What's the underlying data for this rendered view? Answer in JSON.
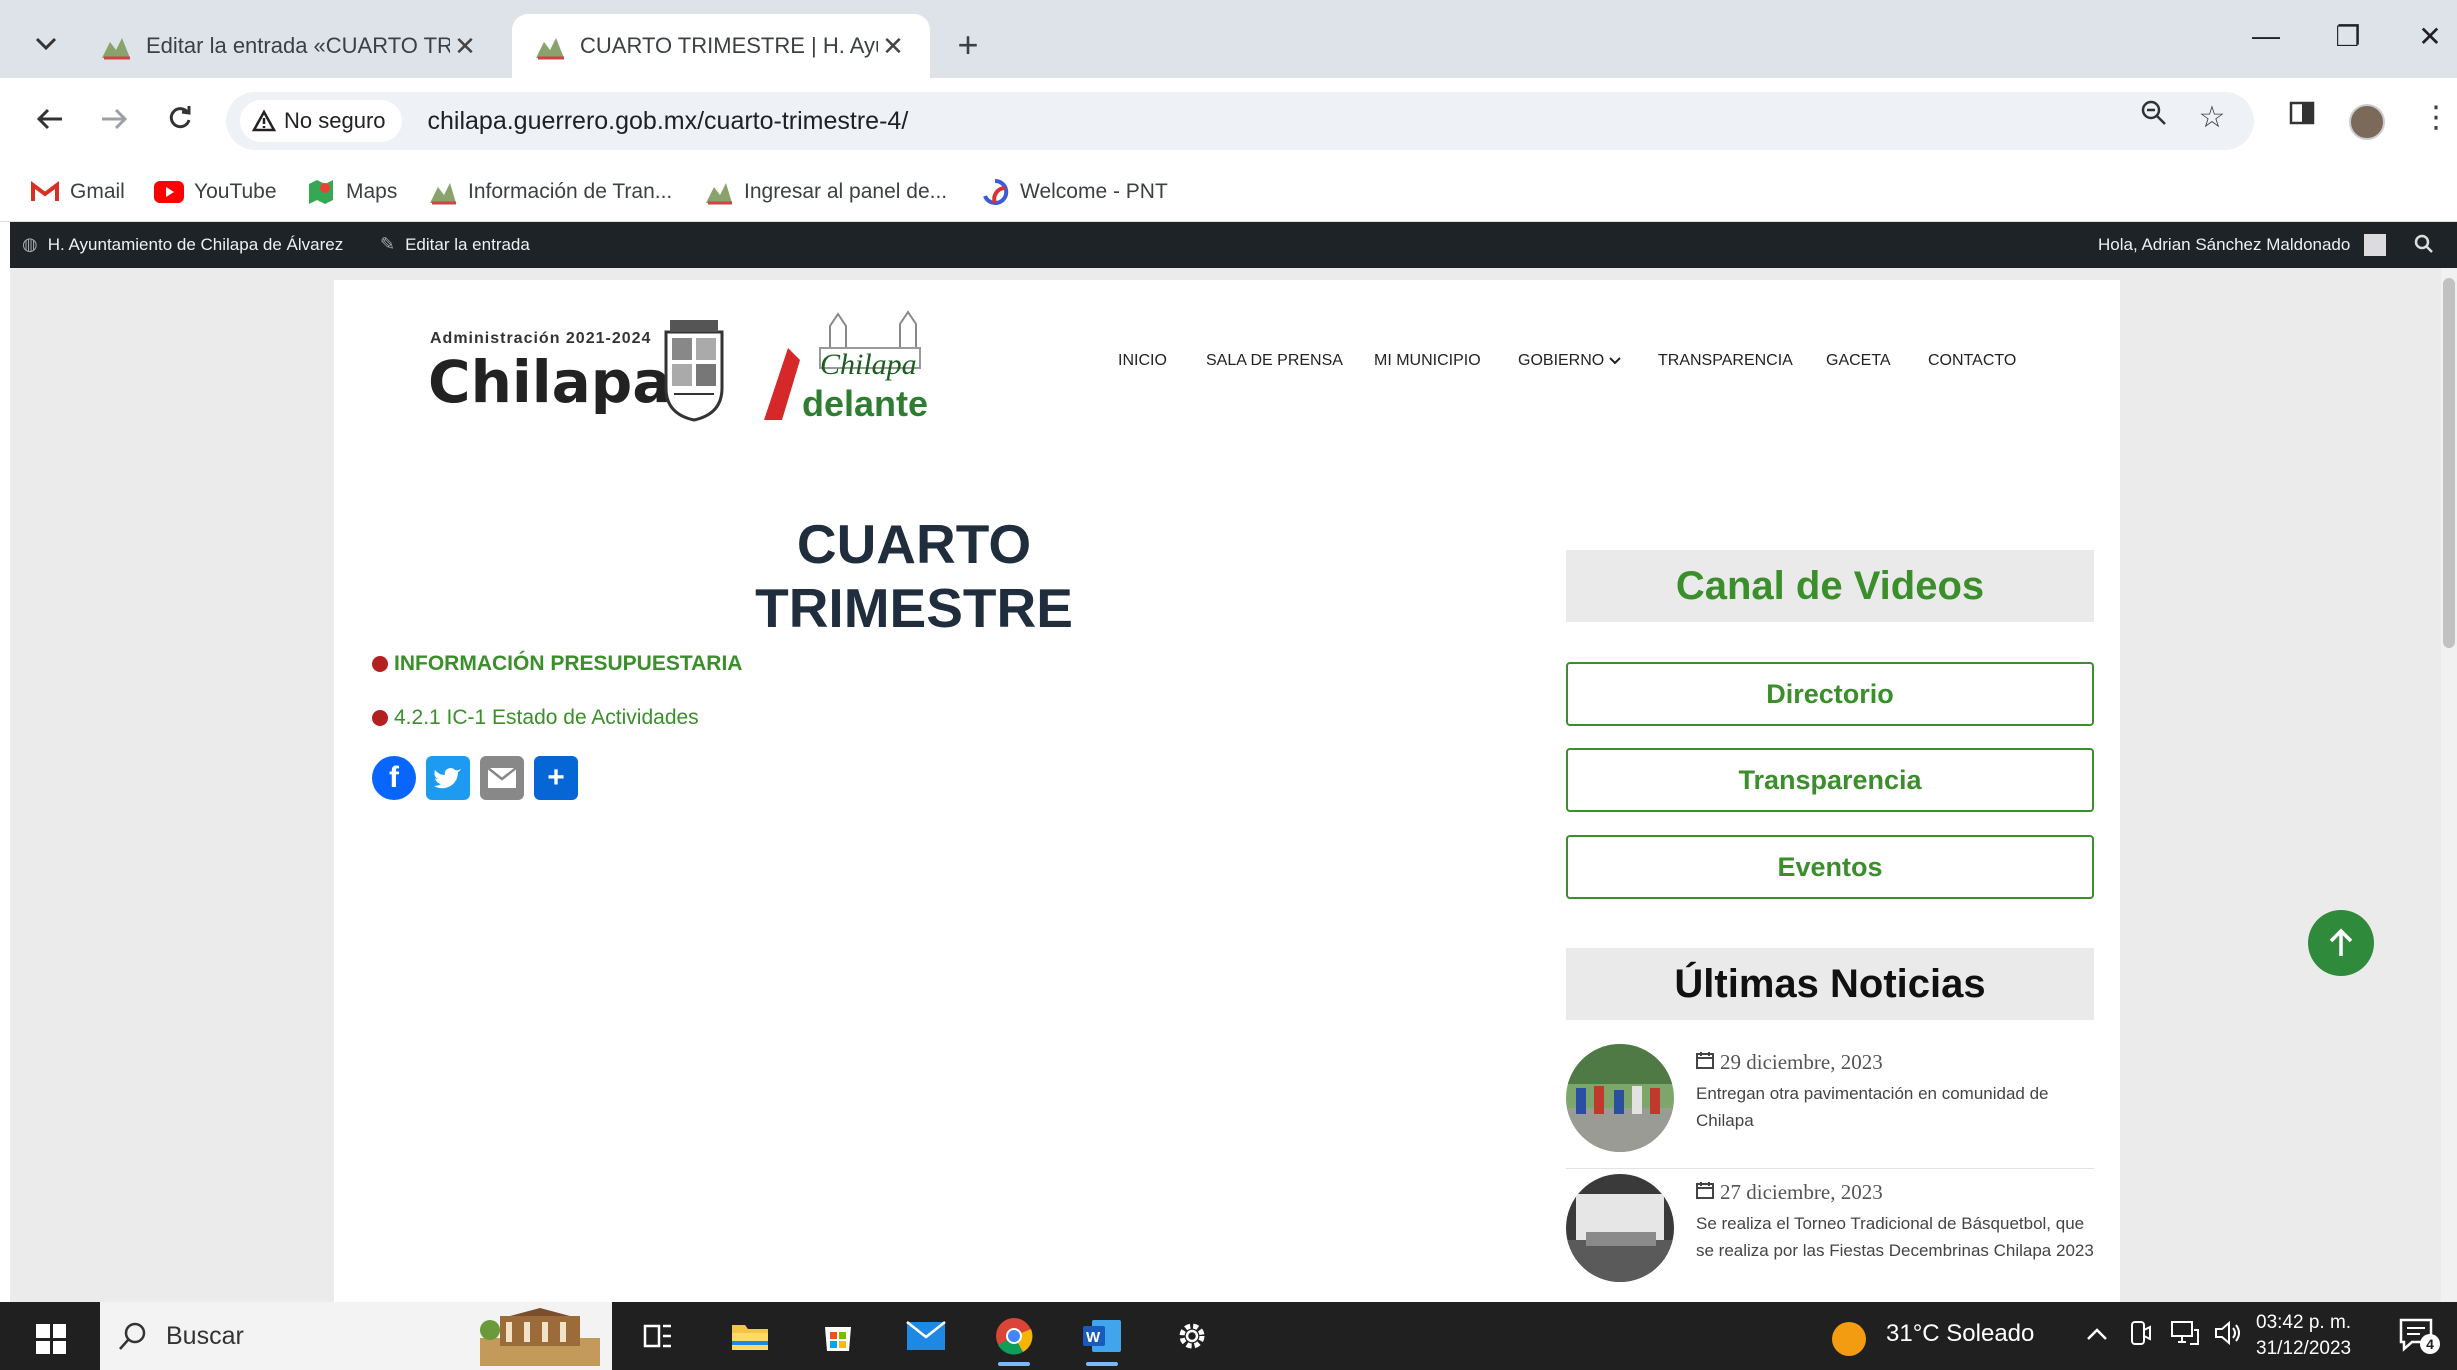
{
  "browser": {
    "tabs": [
      {
        "title": "Editar la entrada «CUARTO TRIMESTRE",
        "close": "✕"
      },
      {
        "title": "CUARTO TRIMESTRE | H. Ayuntamiento",
        "close": "✕"
      }
    ],
    "new_tab": "+",
    "window_controls": {
      "minimize": "—",
      "restore": "❐",
      "close": "✕"
    },
    "security_label": "No seguro",
    "url": "chilapa.guerrero.gob.mx/cuarto-trimestre-4/",
    "bookmarks": [
      {
        "label": "Gmail",
        "icon": "gmail-icon"
      },
      {
        "label": "YouTube",
        "icon": "youtube-icon"
      },
      {
        "label": "Maps",
        "icon": "maps-icon"
      },
      {
        "label": "Información de Tran...",
        "icon": "site-icon"
      },
      {
        "label": "Ingresar al panel de...",
        "icon": "site-icon"
      },
      {
        "label": "Welcome - PNT",
        "icon": "pnt-icon"
      }
    ]
  },
  "adminbar": {
    "site": "H. Ayuntamiento de Chilapa de Álvarez",
    "edit": "Editar la entrada",
    "greeting": "Hola, Adrian Sánchez Maldonado"
  },
  "site": {
    "logo_admin": "Administración 2021-2024",
    "logo_name": "Chilapa",
    "logo_slogan_1": "Chilapa",
    "logo_slogan_2": "delante",
    "nav": [
      "INICIO",
      "SALA DE PRENSA",
      "MI MUNICIPIO",
      "GOBIERNO",
      "TRANSPARENCIA",
      "GACETA",
      "CONTACTO"
    ]
  },
  "content": {
    "title": "CUARTO TRIMESTRE",
    "links": [
      "INFORMACIÓN PRESUPUESTARIA",
      "4.2.1 IC-1 Estado de Actividades"
    ]
  },
  "sidebar": {
    "videos_title": "Canal de Videos",
    "buttons": [
      "Directorio",
      "Transparencia",
      "Eventos"
    ],
    "news_title": "Últimas Noticias",
    "news": [
      {
        "date": "29 diciembre, 2023",
        "text": "Entregan otra pavimentación en comunidad de Chilapa"
      },
      {
        "date": "27 diciembre, 2023",
        "text": "Se realiza el Torneo Tradicional de Básquetbol, que se realiza por las Fiestas Decembrinas Chilapa 2023"
      }
    ]
  },
  "taskbar": {
    "search": "Buscar",
    "weather": "31°C  Soleado",
    "time": "03:42 p. m.",
    "date": "31/12/2023",
    "notifications": "4"
  },
  "colors": {
    "accent_green": "#3a8f2a",
    "title_navy": "#1f2d3d",
    "admin_bar": "#1d2327",
    "bullet_red": "#b41f1f"
  }
}
